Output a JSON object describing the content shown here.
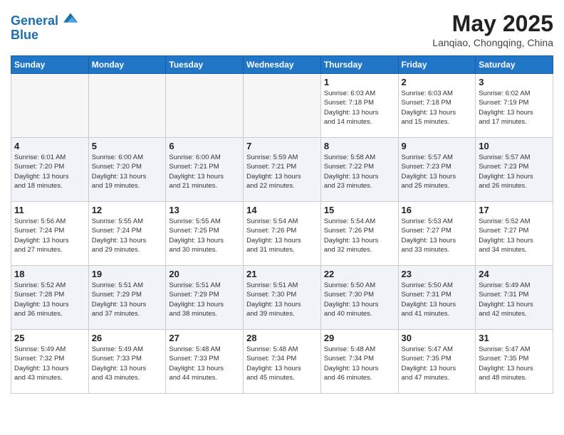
{
  "header": {
    "logo_line1": "General",
    "logo_line2": "Blue",
    "month_title": "May 2025",
    "location": "Lanqiao, Chongqing, China"
  },
  "weekdays": [
    "Sunday",
    "Monday",
    "Tuesday",
    "Wednesday",
    "Thursday",
    "Friday",
    "Saturday"
  ],
  "weeks": [
    [
      {
        "day": "",
        "empty": true
      },
      {
        "day": "",
        "empty": true
      },
      {
        "day": "",
        "empty": true
      },
      {
        "day": "",
        "empty": true
      },
      {
        "day": "1",
        "sunrise": "6:03 AM",
        "sunset": "7:18 PM",
        "daylight": "13 hours and 14 minutes."
      },
      {
        "day": "2",
        "sunrise": "6:03 AM",
        "sunset": "7:18 PM",
        "daylight": "13 hours and 15 minutes."
      },
      {
        "day": "3",
        "sunrise": "6:02 AM",
        "sunset": "7:19 PM",
        "daylight": "13 hours and 17 minutes."
      }
    ],
    [
      {
        "day": "4",
        "sunrise": "6:01 AM",
        "sunset": "7:20 PM",
        "daylight": "13 hours and 18 minutes."
      },
      {
        "day": "5",
        "sunrise": "6:00 AM",
        "sunset": "7:20 PM",
        "daylight": "13 hours and 19 minutes."
      },
      {
        "day": "6",
        "sunrise": "6:00 AM",
        "sunset": "7:21 PM",
        "daylight": "13 hours and 21 minutes."
      },
      {
        "day": "7",
        "sunrise": "5:59 AM",
        "sunset": "7:21 PM",
        "daylight": "13 hours and 22 minutes."
      },
      {
        "day": "8",
        "sunrise": "5:58 AM",
        "sunset": "7:22 PM",
        "daylight": "13 hours and 23 minutes."
      },
      {
        "day": "9",
        "sunrise": "5:57 AM",
        "sunset": "7:23 PM",
        "daylight": "13 hours and 25 minutes."
      },
      {
        "day": "10",
        "sunrise": "5:57 AM",
        "sunset": "7:23 PM",
        "daylight": "13 hours and 26 minutes."
      }
    ],
    [
      {
        "day": "11",
        "sunrise": "5:56 AM",
        "sunset": "7:24 PM",
        "daylight": "13 hours and 27 minutes."
      },
      {
        "day": "12",
        "sunrise": "5:55 AM",
        "sunset": "7:24 PM",
        "daylight": "13 hours and 29 minutes."
      },
      {
        "day": "13",
        "sunrise": "5:55 AM",
        "sunset": "7:25 PM",
        "daylight": "13 hours and 30 minutes."
      },
      {
        "day": "14",
        "sunrise": "5:54 AM",
        "sunset": "7:26 PM",
        "daylight": "13 hours and 31 minutes."
      },
      {
        "day": "15",
        "sunrise": "5:54 AM",
        "sunset": "7:26 PM",
        "daylight": "13 hours and 32 minutes."
      },
      {
        "day": "16",
        "sunrise": "5:53 AM",
        "sunset": "7:27 PM",
        "daylight": "13 hours and 33 minutes."
      },
      {
        "day": "17",
        "sunrise": "5:52 AM",
        "sunset": "7:27 PM",
        "daylight": "13 hours and 34 minutes."
      }
    ],
    [
      {
        "day": "18",
        "sunrise": "5:52 AM",
        "sunset": "7:28 PM",
        "daylight": "13 hours and 36 minutes."
      },
      {
        "day": "19",
        "sunrise": "5:51 AM",
        "sunset": "7:29 PM",
        "daylight": "13 hours and 37 minutes."
      },
      {
        "day": "20",
        "sunrise": "5:51 AM",
        "sunset": "7:29 PM",
        "daylight": "13 hours and 38 minutes."
      },
      {
        "day": "21",
        "sunrise": "5:51 AM",
        "sunset": "7:30 PM",
        "daylight": "13 hours and 39 minutes."
      },
      {
        "day": "22",
        "sunrise": "5:50 AM",
        "sunset": "7:30 PM",
        "daylight": "13 hours and 40 minutes."
      },
      {
        "day": "23",
        "sunrise": "5:50 AM",
        "sunset": "7:31 PM",
        "daylight": "13 hours and 41 minutes."
      },
      {
        "day": "24",
        "sunrise": "5:49 AM",
        "sunset": "7:31 PM",
        "daylight": "13 hours and 42 minutes."
      }
    ],
    [
      {
        "day": "25",
        "sunrise": "5:49 AM",
        "sunset": "7:32 PM",
        "daylight": "13 hours and 43 minutes."
      },
      {
        "day": "26",
        "sunrise": "5:49 AM",
        "sunset": "7:33 PM",
        "daylight": "13 hours and 43 minutes."
      },
      {
        "day": "27",
        "sunrise": "5:48 AM",
        "sunset": "7:33 PM",
        "daylight": "13 hours and 44 minutes."
      },
      {
        "day": "28",
        "sunrise": "5:48 AM",
        "sunset": "7:34 PM",
        "daylight": "13 hours and 45 minutes."
      },
      {
        "day": "29",
        "sunrise": "5:48 AM",
        "sunset": "7:34 PM",
        "daylight": "13 hours and 46 minutes."
      },
      {
        "day": "30",
        "sunrise": "5:47 AM",
        "sunset": "7:35 PM",
        "daylight": "13 hours and 47 minutes."
      },
      {
        "day": "31",
        "sunrise": "5:47 AM",
        "sunset": "7:35 PM",
        "daylight": "13 hours and 48 minutes."
      }
    ]
  ]
}
